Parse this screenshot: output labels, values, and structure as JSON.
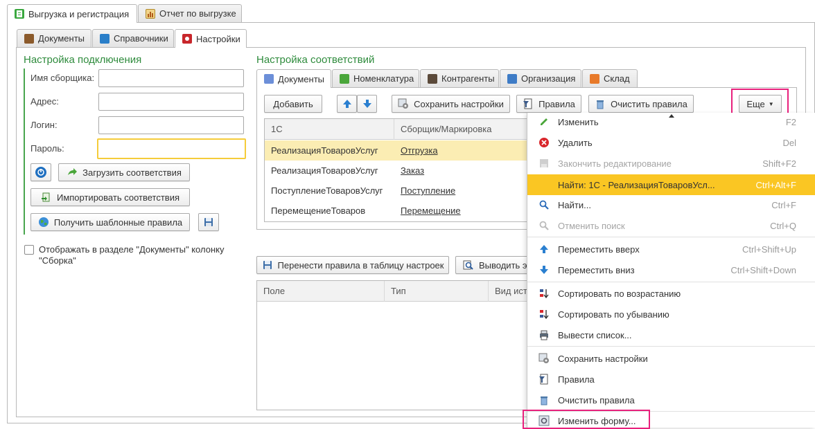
{
  "top_tabs": [
    {
      "label": "Выгрузка и регистрация",
      "icon": "green-doc-icon"
    },
    {
      "label": "Отчет по выгрузке",
      "icon": "report-icon"
    }
  ],
  "sub_tabs": [
    {
      "label": "Документы",
      "icon": "briefcase-icon"
    },
    {
      "label": "Справочники",
      "icon": "book-icon"
    },
    {
      "label": "Настройки",
      "icon": "settings-icon"
    }
  ],
  "connection": {
    "title": "Настройка подключения",
    "fields": [
      {
        "label": "Имя сборщика:",
        "value": ""
      },
      {
        "label": "Адрес:",
        "value": ""
      },
      {
        "label": "Логин:",
        "value": ""
      },
      {
        "label": "Пароль:",
        "value": ""
      }
    ],
    "load_button": "Загрузить соответствия",
    "import_button": "Импортировать соответствия",
    "template_button": "Получить шаблонные правила",
    "checkbox_label": "Отображать в разделе \"Документы\" колонку \"Сборка\"",
    "checkbox_checked": false
  },
  "mapping": {
    "title": "Настройка соответствий",
    "tabs": [
      {
        "label": "Документы",
        "icon": "documents-icon"
      },
      {
        "label": "Номенклатура",
        "icon": "basket-icon"
      },
      {
        "label": "Контрагенты",
        "icon": "people-icon"
      },
      {
        "label": "Организация",
        "icon": "organization-icon"
      },
      {
        "label": "Склад",
        "icon": "house-icon"
      }
    ],
    "toolbar": {
      "add": "Добавить",
      "save_settings": "Сохранить настройки",
      "rules": "Правила",
      "clear_rules": "Очистить правила",
      "more": "Еще"
    },
    "columns": [
      "1С",
      "Сборщик/Маркировка"
    ],
    "rows": [
      [
        "РеализацияТоваровУслуг",
        "Отгрузка"
      ],
      [
        "РеализацияТоваровУслуг",
        "Заказ"
      ],
      [
        "ПоступлениеТоваровУслуг",
        "Поступление"
      ],
      [
        "ПеремещениеТоваров",
        "Перемещение"
      ]
    ],
    "selected_row": 0
  },
  "lower": {
    "transfer_button": "Перенести правила в таблицу настроек",
    "output_button": "Выводить эк",
    "columns": [
      "Поле",
      "Тип",
      "Вид ист"
    ]
  },
  "menu": {
    "items": [
      {
        "label": "Изменить",
        "key": "F2",
        "icon": "pencil-icon",
        "disabled": false
      },
      {
        "label": "Удалить",
        "key": "Del",
        "icon": "delete-icon",
        "disabled": false
      },
      {
        "label": "Закончить редактирование",
        "key": "Shift+F2",
        "icon": "end-edit-icon",
        "disabled": true
      },
      {
        "label": "Найти: 1С - РеализацияТоваровУсл...",
        "key": "Ctrl+Alt+F",
        "icon": "",
        "disabled": false,
        "highlight": true
      },
      {
        "label": "Найти...",
        "key": "Ctrl+F",
        "icon": "find-icon",
        "disabled": false
      },
      {
        "label": "Отменить поиск",
        "key": "Ctrl+Q",
        "icon": "cancel-search-icon",
        "disabled": true
      },
      {
        "label": "Переместить вверх",
        "key": "Ctrl+Shift+Up",
        "icon": "arrow-up-icon",
        "disabled": false
      },
      {
        "label": "Переместить вниз",
        "key": "Ctrl+Shift+Down",
        "icon": "arrow-down-icon",
        "disabled": false
      },
      {
        "label": "Сортировать по возрастанию",
        "key": "",
        "icon": "sort-asc-icon",
        "disabled": false
      },
      {
        "label": "Сортировать по убыванию",
        "key": "",
        "icon": "sort-desc-icon",
        "disabled": false
      },
      {
        "label": "Вывести список...",
        "key": "",
        "icon": "print-list-icon",
        "disabled": false
      },
      {
        "label": "Сохранить настройки",
        "key": "",
        "icon": "save-settings-icon",
        "disabled": false
      },
      {
        "label": "Правила",
        "key": "",
        "icon": "rules-icon",
        "disabled": false
      },
      {
        "label": "Очистить правила",
        "key": "",
        "icon": "trash-icon",
        "disabled": false
      },
      {
        "label": "Изменить форму...",
        "key": "",
        "icon": "change-form-icon",
        "disabled": false
      }
    ]
  },
  "colors": {
    "accent_green": "#2e8b3c",
    "highlight_yellow": "#fac623",
    "selected_row": "#fbedb3",
    "annotation_pink": "#e8207c"
  }
}
